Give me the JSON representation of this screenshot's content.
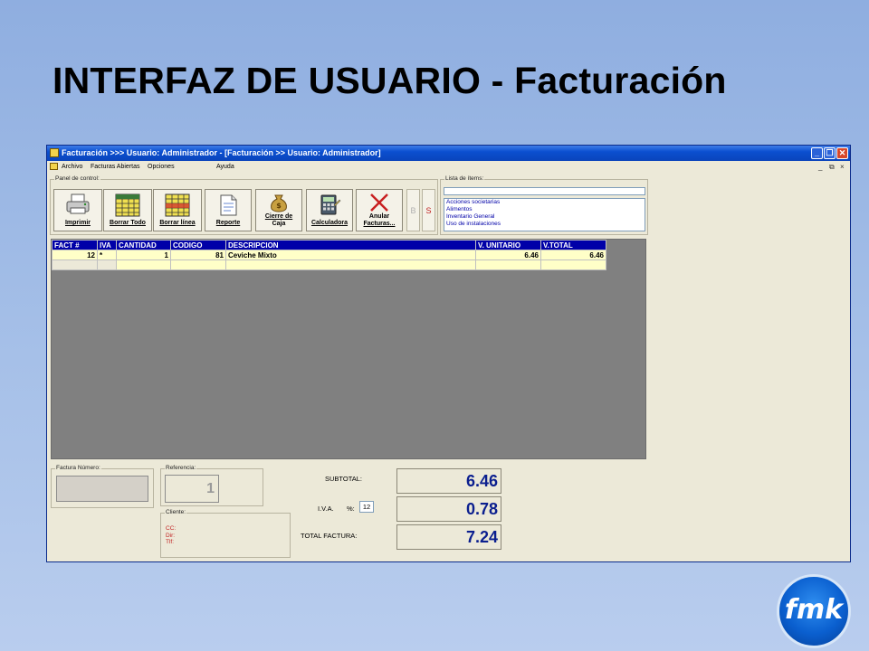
{
  "slide": {
    "title": "INTERFAZ DE USUARIO - Facturación",
    "logo_text": "fmk"
  },
  "window": {
    "title": "Facturación >>> Usuario: Administrador - [Facturación >> Usuario: Administrador]",
    "title_color": "#0b4fd0",
    "window_controls": [
      "minimize-icon",
      "restore-icon",
      "close-icon"
    ]
  },
  "menubar": {
    "items": [
      "Archivo",
      "Facturas Abiertas",
      "Opciones",
      "Ayuda"
    ],
    "mdi_controls": [
      "_",
      "ā",
      "×"
    ]
  },
  "control_panel": {
    "label": "Panel de control:",
    "buttons": [
      {
        "label": "Imprimir",
        "icon": "printer-icon"
      },
      {
        "label": "Borrar Todo",
        "icon": "grid-clear-icon"
      },
      {
        "label": "Borrar línea",
        "icon": "grid-line-icon"
      },
      {
        "label": "Reporte",
        "icon": "report-icon"
      },
      {
        "label_line1": "Cierre de",
        "label_line2": "Caja",
        "icon": "money-bag-icon"
      },
      {
        "label": "Calculadora",
        "icon": "calculator-icon"
      },
      {
        "label_line1": "Anular",
        "label_line2": "Facturas...",
        "icon": "cancel-x-icon"
      }
    ],
    "b_label": "B",
    "s_label": "S"
  },
  "item_list": {
    "label": "Lista de ítems:",
    "search_value": "",
    "items": [
      "Acciones societarias",
      "Alimentos",
      "Inventario General",
      "Uso de instalaciones"
    ]
  },
  "invoice_table": {
    "columns": [
      "FACT #",
      "IVA",
      "CANTIDAD",
      "CODIGO",
      "DESCRIPCION",
      "V. UNITARIO",
      "V.TOTAL"
    ],
    "rows": [
      {
        "fact": "12",
        "iva": "*",
        "cantidad": "1",
        "codigo": "81",
        "descripcion": "Ceviche Mixto",
        "unitario": "6.46",
        "total": "6.46"
      }
    ],
    "header_color": "#0000a8",
    "row_color": "#ffffc8"
  },
  "footer": {
    "factura_numero_label": "Factura Número:",
    "factura_numero_value": "",
    "referencia_label": "Referencia:",
    "referencia_value": "1",
    "cliente_label": "Cliente:",
    "cliente_cc": "CC:",
    "cliente_dir": "Dir:",
    "cliente_tlf": "Tlf:"
  },
  "totals": {
    "subtotal_label": "SUBTOTAL:",
    "subtotal_value": "6.46",
    "iva_label": "I.V.A.",
    "iva_pct_label": "%:",
    "iva_pct_value": "12",
    "iva_value": "0.78",
    "total_label": "TOTAL FACTURA:",
    "total_value": "7.24",
    "value_color": "#0b1f8f"
  }
}
